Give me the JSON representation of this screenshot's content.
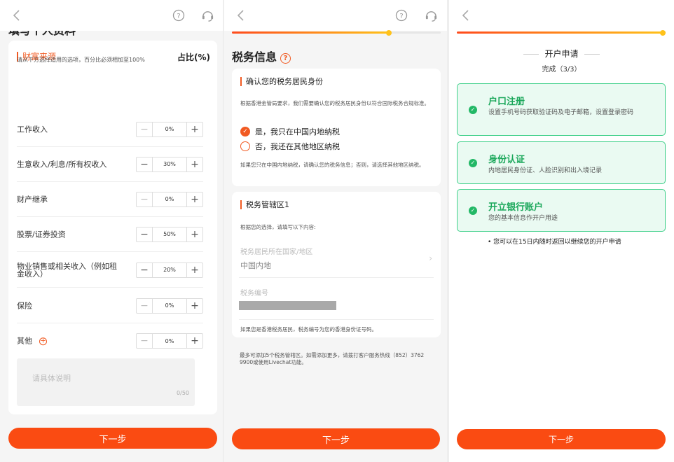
{
  "nav": {
    "back_icon": "chevron-left-icon",
    "help_icon": "question-circle-icon",
    "support_icon": "headset-icon"
  },
  "panel1": {
    "page_title_partial": "填写个人资料",
    "section_title": "财富来源",
    "section_right": "占比(%)",
    "hint": "请从下方选择适用的选项，百分比必须相加至100%",
    "rows": [
      {
        "label": "工作收入",
        "value": "0%"
      },
      {
        "label": "生意收入/利息/所有权收入",
        "value": "30%"
      },
      {
        "label": "财产继承",
        "value": "0%"
      },
      {
        "label": "股票/证券投资",
        "value": "50%"
      },
      {
        "label": "物业销售或相关收入（例如租金收入）",
        "value": "20%"
      },
      {
        "label": "保险",
        "value": "0%"
      },
      {
        "label": "其他",
        "value": "0%"
      }
    ],
    "stepper_minus": "−",
    "stepper_plus": "+",
    "other_add": "+",
    "textarea_placeholder": "请具体说明",
    "textarea_count": "0/50",
    "next": "下一步"
  },
  "panel2": {
    "progress": 0.75,
    "title": "税务信息",
    "title_help": "?",
    "card1": {
      "heading": "确认您的税务居民身份",
      "desc": "根据香港金管局要求，我们需要确认您的税务居民身份以符合国际税务合规标准。",
      "option_yes": "是，我只在中国内地纳税",
      "option_no": "否，我还在其他地区纳税",
      "selected": "yes",
      "note": "如果您只在中国内地纳税，请确认您的税务信息；否则，请选择其他地区纳税。"
    },
    "card2": {
      "heading": "税务管辖区1",
      "desc": "根据您的选择，请填写以下内容:",
      "country_label": "税务居民所在国家/地区",
      "country_value": "中国内地",
      "tax_no_label": "税务编号",
      "note": "如果您是香港税务居民，税务编号为您的香港身份证号码。"
    },
    "footer_note": "最多可添加5个税务管辖区。如需添加更多，请拨打客户服务热线（852）3762 9900或使用Livechat功能。",
    "next": "下一步"
  },
  "panel3": {
    "progress": 1.0,
    "title": "开户申请",
    "subtitle": "完成（3/3）",
    "steps": [
      {
        "title": "户口注册",
        "desc": "设置手机号码获取验证码及电子邮箱，设置登录密码"
      },
      {
        "title": "身份认证",
        "desc": "内地居民身份证、人脸识别和出入境记录"
      },
      {
        "title": "开立银行账户",
        "desc": "您的基本信息作开户用途"
      }
    ],
    "note": "• 您可以在15日内随时返回以继续您的开户申请",
    "next": "下一步"
  }
}
